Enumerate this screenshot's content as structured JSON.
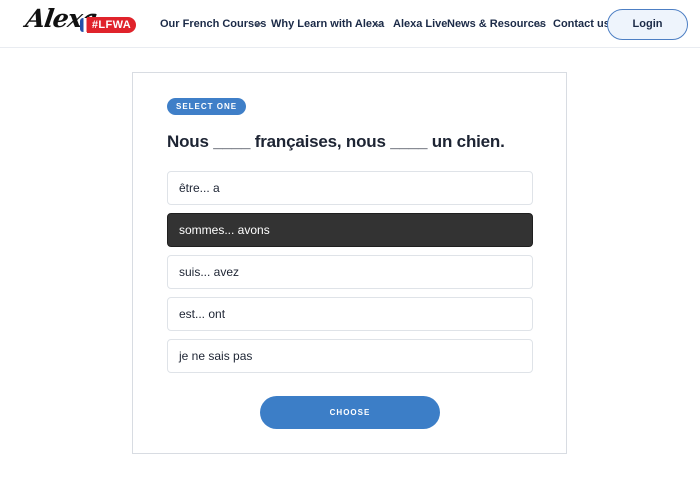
{
  "header": {
    "logo_text": "Alexa",
    "badge": "#LFWA",
    "nav": [
      {
        "label": "Our French Courses",
        "has_dropdown": true
      },
      {
        "label": "Why Learn with Alexa",
        "has_dropdown": true
      },
      {
        "label": "Alexa Live",
        "has_dropdown": false
      },
      {
        "label": "News & Resources",
        "has_dropdown": true
      },
      {
        "label": "Contact us",
        "has_dropdown": false
      }
    ],
    "login_label": "Login"
  },
  "quiz": {
    "tag": "SELECT ONE",
    "question": "Nous ____ françaises, nous ____ un chien.",
    "options": [
      {
        "label": "être... a",
        "selected": false
      },
      {
        "label": "sommes... avons",
        "selected": true
      },
      {
        "label": "suis... avez",
        "selected": false
      },
      {
        "label": "est... ont",
        "selected": false
      },
      {
        "label": "je ne sais pas",
        "selected": false
      }
    ],
    "submit_label": "CHOOSE"
  },
  "colors": {
    "accent": "#3c7ec7",
    "selected_option_bg": "#333333",
    "badge_red": "#e0232b",
    "nav_text": "#1b2a47"
  },
  "icons": {
    "dropdown": "chevron-down-icon",
    "flag": "french-flag-icon"
  }
}
